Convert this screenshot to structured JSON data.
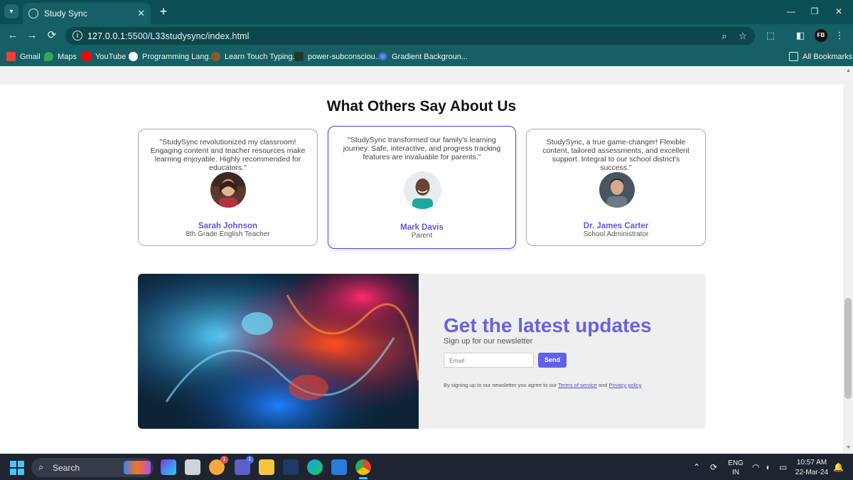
{
  "browser": {
    "tab_title": "Study Sync",
    "tab_close": "✕",
    "new_tab": "+",
    "url_host": "127.0.0.1",
    "url_rest": ":5500/L33studysync/index.html",
    "window_controls": [
      "—",
      "❐",
      "✕"
    ],
    "bookmarks": [
      {
        "label": "Gmail",
        "icon": "gmail-icon",
        "color": "#ea4335"
      },
      {
        "label": "Maps",
        "icon": "maps-icon",
        "color": "#34a853"
      },
      {
        "label": "YouTube",
        "icon": "youtube-icon",
        "color": "#ff0000"
      },
      {
        "label": "Programming Lang...",
        "icon": "globe-icon",
        "color": "#ffffff"
      },
      {
        "label": "Learn Touch Typing...",
        "icon": "typing-icon",
        "color": "#8b5a2b"
      },
      {
        "label": "power-subconsciou...",
        "icon": "bookmark-icon",
        "color": "#1f3a2a"
      },
      {
        "label": "Gradient Backgroun...",
        "icon": "gradient-icon",
        "color": "#2563eb"
      }
    ],
    "all_bookmarks": "All Bookmarks",
    "profile_initials": "FB"
  },
  "page": {
    "section_title": "What Others Say About Us",
    "testimonials": [
      {
        "quote": "\"StudySync revolutionized my classroom! Engaging content and teacher resources make learning enjoyable. Highly recommended for educators.\"",
        "name": "Sarah Johnson",
        "role": "8th Grade English Teacher",
        "avatar_color": "#b8323e"
      },
      {
        "quote": "\"StudySync transformed our family's learning journey. Safe, interactive, and progress tracking features are invaluable for parents.\"",
        "name": "Mark Davis",
        "role": "Parent",
        "avatar_color": "#1ba8a0"
      },
      {
        "quote": "StudySync, a true game-changer! Flexible content, tailored assessments, and excellent support. Integral to our school district's success.\"",
        "name": "Dr. James Carter",
        "role": "School Administrator",
        "avatar_color": "#6b7a86"
      }
    ],
    "newsletter": {
      "heading": "Get the latest updates",
      "subheading": "Sign up for our newsletter",
      "email_placeholder": "Email",
      "send_label": "Send",
      "legal_prefix": "By signing up to our newsletter you agree to our",
      "terms_label": "Terms of service",
      "legal_and": "and",
      "privacy_label": "Privacy policy"
    }
  },
  "taskbar": {
    "search_label": "Search",
    "language": "ENG",
    "region": "IN",
    "time": "10:57 AM",
    "date": "22-Mar-24",
    "badges": [
      "1",
      "1"
    ]
  },
  "colors": {
    "chrome_dark": "#0b4f55",
    "chrome_toolbar": "#165f64",
    "accent": "#6060e6",
    "featured_border": "#4f46e5"
  }
}
